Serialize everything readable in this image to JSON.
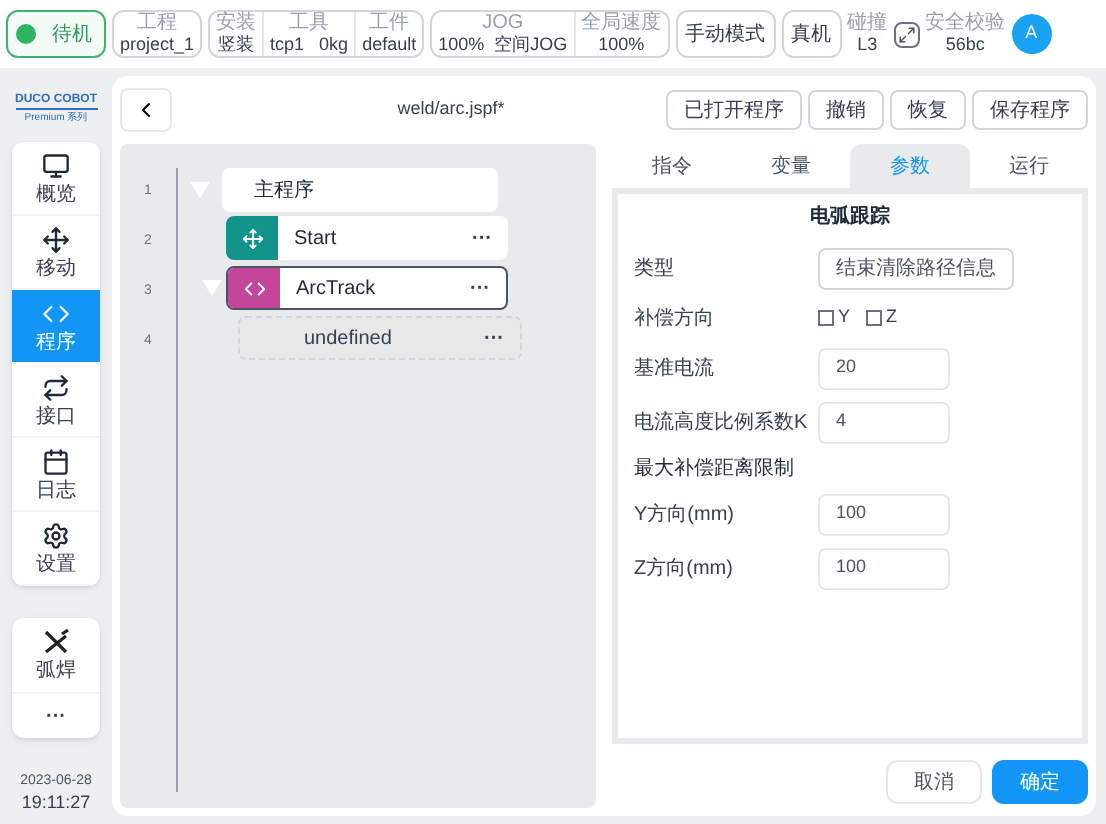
{
  "header": {
    "status": {
      "label": "待机",
      "on": true
    },
    "groups": [
      {
        "fields": [
          {
            "label": "工程",
            "value": "project_1"
          }
        ]
      },
      {
        "fields": [
          {
            "label": "安装",
            "value": "竖装"
          },
          {
            "label": "工具",
            "value": "tcp1   0kg"
          },
          {
            "label": "工件",
            "value": "default"
          }
        ]
      },
      {
        "fields": [
          {
            "label": "JOG",
            "value": "100%  空间JOG"
          },
          {
            "label": "全局速度",
            "value": "100%"
          }
        ]
      }
    ],
    "mode_button": "手动模式",
    "real_button": "真机",
    "collision": {
      "label": "碰撞",
      "value": "L3"
    },
    "safety": {
      "label": "安全校验",
      "value": "56bc"
    },
    "avatar": "A"
  },
  "sidebar": {
    "logo": "DUCO COBOT",
    "logo_sub": "Premium 系列",
    "items": [
      {
        "kind": "monitor",
        "label": "概览",
        "selected": false
      },
      {
        "kind": "move",
        "label": "移动",
        "selected": false
      },
      {
        "kind": "code",
        "label": "程序",
        "selected": true
      },
      {
        "kind": "repeat",
        "label": "接口",
        "selected": false
      },
      {
        "kind": "calendar",
        "label": "日志",
        "selected": false
      },
      {
        "kind": "gear",
        "label": "设置",
        "selected": false
      }
    ],
    "extras": [
      {
        "kind": "weld",
        "label": "弧焊"
      },
      {
        "kind": "more",
        "label": "···"
      }
    ],
    "date": "2023-06-28",
    "time": "19:11:27"
  },
  "toolbar": {
    "title": "weld/arc.jspf*",
    "buttons": [
      "已打开程序",
      "撤销",
      "恢复",
      "保存程序"
    ]
  },
  "tree": [
    {
      "kind": "root",
      "label": "主程序",
      "expanded": true,
      "selected": false,
      "children": [
        {
          "kind": "move",
          "label": "Start",
          "selected": false,
          "menu": "···"
        },
        {
          "kind": "script",
          "label": "ArcTrack",
          "selected": true,
          "expanded": true,
          "menu": "···",
          "children": [
            {
              "kind": "placeholder",
              "label": "undefined",
              "selected": false,
              "menu": "···"
            }
          ]
        }
      ]
    }
  ],
  "line_numbers": [
    "1",
    "2",
    "3",
    "4"
  ],
  "tabs": [
    {
      "label": "指令",
      "selected": false
    },
    {
      "label": "变量",
      "selected": false
    },
    {
      "label": "参数",
      "selected": true
    },
    {
      "label": "运行",
      "selected": false
    }
  ],
  "form": {
    "title": "电弧跟踪",
    "rows": [
      {
        "kind": "select",
        "label": "类型",
        "value": "结束清除路径信息"
      },
      {
        "kind": "checks",
        "label": "补偿方向",
        "options": [
          {
            "label": "Y",
            "checked": false
          },
          {
            "label": "Z",
            "checked": false
          }
        ]
      },
      {
        "kind": "input",
        "label": "基准电流",
        "value": "20"
      },
      {
        "kind": "input",
        "label": "电流高度比例系数K",
        "value": "4"
      },
      {
        "kind": "section",
        "label": "最大补偿距离限制"
      },
      {
        "kind": "input",
        "label": "Y方向(mm)",
        "value": "100"
      },
      {
        "kind": "input",
        "label": "Z方向(mm)",
        "value": "100"
      }
    ]
  },
  "footer": {
    "cancel": "取消",
    "confirm": "确定"
  }
}
